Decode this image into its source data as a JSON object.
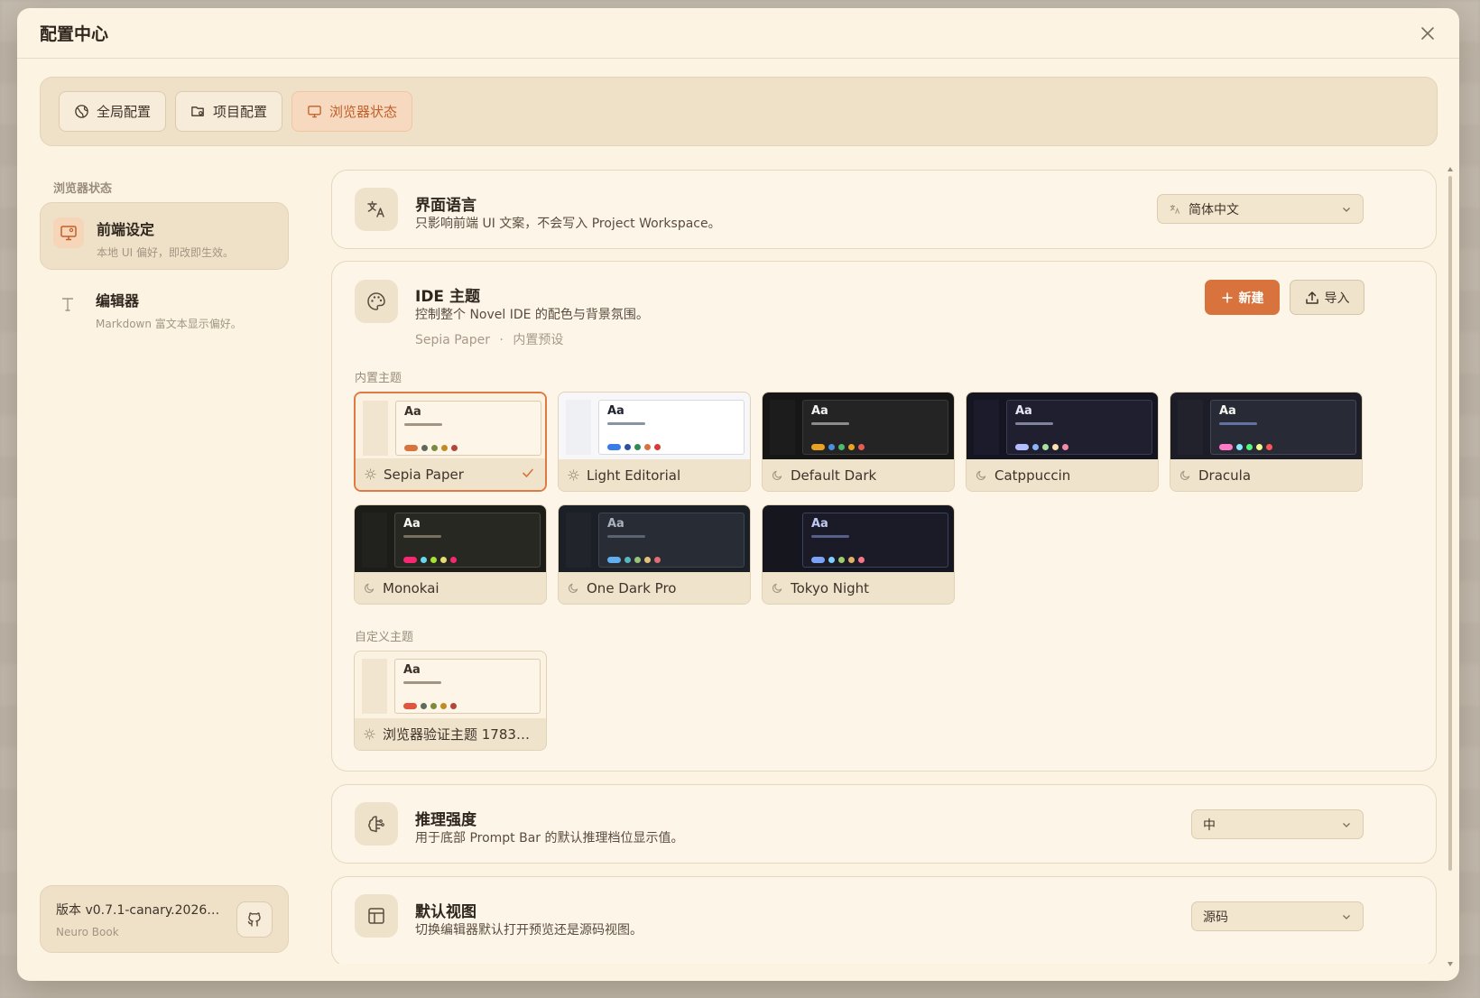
{
  "modal": {
    "title": "配置中心"
  },
  "tabs": [
    {
      "label": "全局配置",
      "icon": "globe-icon",
      "active": false
    },
    {
      "label": "项目配置",
      "icon": "folder-gear-icon",
      "active": false
    },
    {
      "label": "浏览器状态",
      "icon": "monitor-icon",
      "active": true
    }
  ],
  "sidebar": {
    "heading": "浏览器状态",
    "items": [
      {
        "title": "前端设定",
        "desc": "本地 UI 偏好，即改即生效。",
        "icon": "monitor-gear-icon",
        "active": true
      },
      {
        "title": "编辑器",
        "desc": "Markdown 富文本显示偏好。",
        "icon": "text-icon",
        "active": false
      }
    ],
    "version": {
      "text": "版本 v0.7.1-canary.20260…",
      "sub": "Neuro Book"
    }
  },
  "language": {
    "title": "界面语言",
    "desc": "只影响前端 UI 文案，不会写入 Project Workspace。",
    "value": "简体中文"
  },
  "theme": {
    "title": "IDE 主题",
    "desc": "控制整个 Novel IDE 的配色与背景氛围。",
    "current": "Sepia Paper",
    "current_sep": "·",
    "current_type": "内置预设",
    "new_label": "新建",
    "import_label": "导入",
    "builtin_label": "内置主题",
    "custom_label": "自定义主题",
    "builtin": [
      {
        "name": "Sepia Paper",
        "mode": "light",
        "selected": true,
        "colors": {
          "bg": "#fbf2e1",
          "side": "#f1e5d0",
          "main": "#fdf6e8",
          "border": "#dccbae",
          "text": "#3b3026",
          "bar": "#a39583",
          "dots": [
            "#d9733e",
            "#5e6b5a",
            "#7d8a3b",
            "#c48a22",
            "#b3463a"
          ]
        }
      },
      {
        "name": "Light Editorial",
        "mode": "light",
        "selected": false,
        "colors": {
          "bg": "#f7f7f9",
          "side": "#eef0f4",
          "main": "#ffffff",
          "border": "#d6d9e0",
          "text": "#1f2330",
          "bar": "#8a93a6",
          "dots": [
            "#3a7be8",
            "#2c4fa3",
            "#2e8b57",
            "#d9733e",
            "#d83a3a"
          ]
        }
      },
      {
        "name": "Default Dark",
        "mode": "dark",
        "selected": false,
        "colors": {
          "bg": "#161616",
          "side": "#1c1c1c",
          "main": "#242424",
          "border": "#3a3a3a",
          "text": "#f3f3f3",
          "bar": "#8c8c8c",
          "dots": [
            "#e8a322",
            "#4a90e2",
            "#4cbb6c",
            "#e8a322",
            "#e85a5a"
          ]
        }
      },
      {
        "name": "Catppuccin",
        "mode": "dark",
        "selected": false,
        "colors": {
          "bg": "#151521",
          "side": "#1b1b2b",
          "main": "#1f1f30",
          "border": "#3a3a52",
          "text": "#e6e8f5",
          "bar": "#7f849c",
          "dots": [
            "#b4befe",
            "#89b4fa",
            "#a6e3a1",
            "#f9e2af",
            "#f38ba8"
          ]
        }
      },
      {
        "name": "Dracula",
        "mode": "dark",
        "selected": false,
        "colors": {
          "bg": "#1c1d27",
          "side": "#21222c",
          "main": "#282a36",
          "border": "#44475a",
          "text": "#f8f8f2",
          "bar": "#6272a4",
          "dots": [
            "#ff79c6",
            "#8be9fd",
            "#50fa7b",
            "#f1fa8c",
            "#ff5555"
          ]
        }
      },
      {
        "name": "Monokai",
        "mode": "dark",
        "selected": false,
        "colors": {
          "bg": "#1c1d19",
          "side": "#21221e",
          "main": "#272822",
          "border": "#49483e",
          "text": "#f8f8f2",
          "bar": "#75715e",
          "dots": [
            "#f92672",
            "#66d9ef",
            "#a6e22e",
            "#e6db74",
            "#f92672"
          ]
        }
      },
      {
        "name": "One Dark Pro",
        "mode": "dark",
        "selected": false,
        "colors": {
          "bg": "#1b1f26",
          "side": "#21252b",
          "main": "#282c34",
          "border": "#3e4451",
          "text": "#abb2bf",
          "bar": "#5c6370",
          "dots": [
            "#61afef",
            "#56b6c2",
            "#98c379",
            "#e5c07b",
            "#e06c75"
          ]
        }
      },
      {
        "name": "Tokyo Night",
        "mode": "dark",
        "selected": false,
        "colors": {
          "bg": "#15161f",
          "side": "#16161e",
          "main": "#1a1b26",
          "border": "#3b4261",
          "text": "#c0caf5",
          "bar": "#565f89",
          "dots": [
            "#7aa2f7",
            "#7dcfff",
            "#9ece6a",
            "#e0af68",
            "#f7768e"
          ]
        }
      }
    ],
    "custom": [
      {
        "name": "浏览器验证主题 178332…",
        "mode": "light",
        "selected": false,
        "colors": {
          "bg": "#fbf2e1",
          "side": "#f1e5d0",
          "main": "#fdf6e8",
          "border": "#dccbae",
          "text": "#3b3026",
          "bar": "#a39583",
          "dots": [
            "#e0553e",
            "#5e6b5a",
            "#7d8a3b",
            "#c48a22",
            "#b3463a"
          ]
        }
      }
    ]
  },
  "reasoning": {
    "title": "推理强度",
    "desc": "用于底部 Prompt Bar 的默认推理档位显示值。",
    "value": "中"
  },
  "default_view": {
    "title": "默认视图",
    "desc": "切换编辑器默认打开预览还是源码视图。",
    "value": "源码"
  },
  "accent": "#d9733e"
}
